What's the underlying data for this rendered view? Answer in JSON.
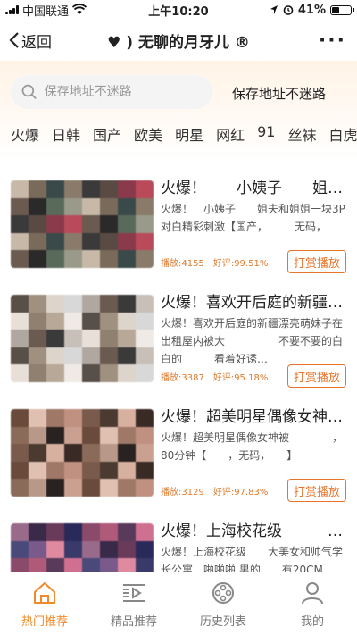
{
  "status_bar": {
    "carrier": "中国联通",
    "time": "上午10:20",
    "battery": "41%",
    "battery_level": 0.41
  },
  "nav": {
    "back_label": "返回",
    "title": "♥ ) 无聊的月牙儿 ®",
    "more": "···"
  },
  "search": {
    "placeholder": "保存地址不迷路",
    "tip": "保存地址不迷路"
  },
  "categories": [
    "火爆",
    "日韩",
    "国产",
    "欧美",
    "明星",
    "网红",
    "91",
    "丝袜",
    "白虎"
  ],
  "items": [
    {
      "title": "火爆！　　小姨子　　姐…",
      "desc": "火爆！　小姨子　　姐夫和姐姐一块3P对白精彩刺激【国产，　　　无码，",
      "plays": "播放:4155",
      "rating": "好评:99.51%",
      "button": "打赏播放"
    },
    {
      "title": "火爆！喜欢开后庭的新疆…",
      "desc": "火爆！喜欢开后庭的新疆漂亮萌妹子在出租屋内被大　　　　　不要不要的白白的　　　看着好诱…",
      "plays": "播放:3387",
      "rating": "好评:95.18%",
      "button": "打赏播放"
    },
    {
      "title": "火爆！超美明星偶像女神…",
      "desc": "火爆！超美明星偶像女神被　　　　，　　80分钟【　　，无码，　　】",
      "plays": "播放:3129",
      "rating": "好评:97.83%",
      "button": "打赏播放"
    },
    {
      "title": "火爆！上海校花级　　　大…",
      "desc": "火爆！上海校花级　　大美女和帅气学长公寓　啪啪啪,男的　　有20CM",
      "plays": "",
      "rating": "",
      "button": ""
    }
  ],
  "tabs": [
    {
      "label": "热门推荐",
      "icon": "home-icon",
      "active": true
    },
    {
      "label": "精品推荐",
      "icon": "video-list-icon",
      "active": false
    },
    {
      "label": "历史列表",
      "icon": "film-reel-icon",
      "active": false
    },
    {
      "label": "我的",
      "icon": "user-icon",
      "active": false
    }
  ],
  "colors": {
    "accent": "#f08a2b"
  }
}
